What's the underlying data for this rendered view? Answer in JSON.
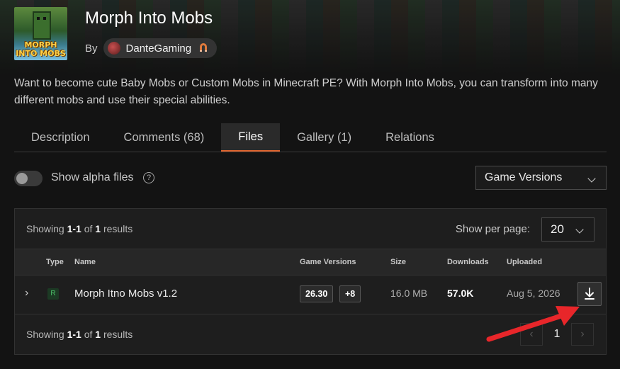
{
  "mod": {
    "title": "Morph Into Mobs",
    "by_label": "By",
    "author": "DanteGaming",
    "logo_text": "MORPH INTO MOBS",
    "description": "Want to become cute Baby Mobs or Custom Mobs in Minecraft PE? With Morph Into Mobs, you can transform into many different mobs and use their special abilities."
  },
  "tabs": [
    {
      "label": "Description"
    },
    {
      "label": "Comments (68)"
    },
    {
      "label": "Files"
    },
    {
      "label": "Gallery (1)"
    },
    {
      "label": "Relations"
    }
  ],
  "active_tab": "Files",
  "filters": {
    "alpha_label": "Show alpha files",
    "alpha_enabled": false,
    "help_glyph": "?",
    "game_versions_label": "Game Versions"
  },
  "results": {
    "showing_prefix": "Showing",
    "range": "1-1",
    "of_word": "of",
    "total": "1",
    "results_word": "results",
    "per_page_label": "Show per page:",
    "per_page_value": "20"
  },
  "table": {
    "headers": {
      "type": "Type",
      "name": "Name",
      "game_versions": "Game Versions",
      "size": "Size",
      "downloads": "Downloads",
      "uploaded": "Uploaded"
    },
    "rows": [
      {
        "type_badge": "R",
        "name": "Morph Itno Mobs v1.2",
        "version": "26.30",
        "more_versions": "+8",
        "size": "16.0 MB",
        "downloads": "57.0K",
        "uploaded": "Aug 5, 2026"
      }
    ]
  },
  "pagination": {
    "current": "1",
    "prev_glyph": "‹",
    "next_glyph": "›"
  },
  "colors": {
    "accent": "#e0642e",
    "annotation_arrow": "#e8262a",
    "release_badge": "#4ec46b"
  },
  "icons": [
    "chevron-down-icon",
    "help-circle-icon",
    "download-icon",
    "magnet-icon",
    "chevron-right-icon"
  ]
}
